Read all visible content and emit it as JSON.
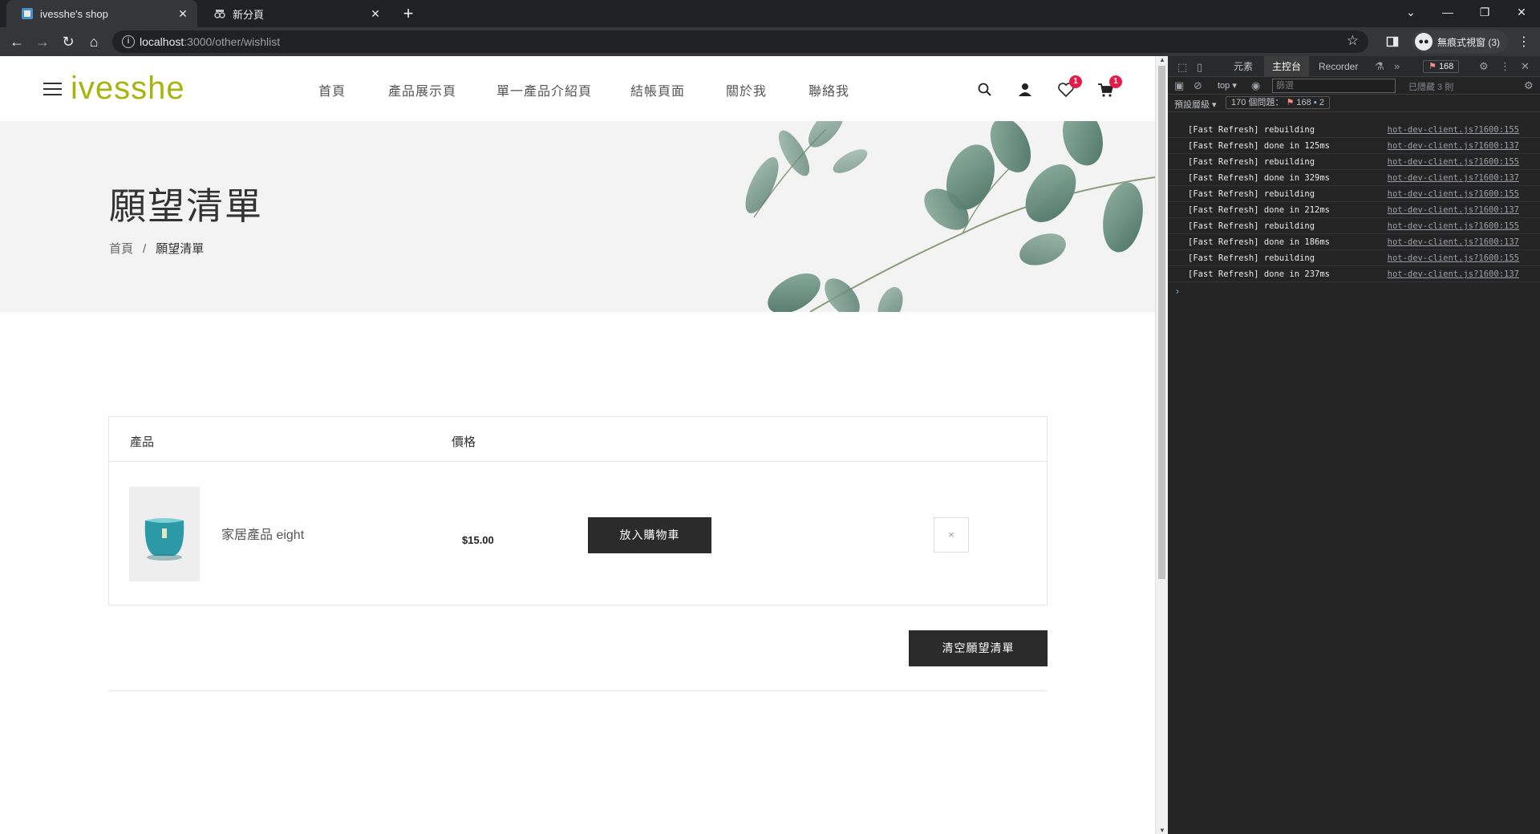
{
  "browser": {
    "tabs": [
      {
        "title": "ivesshe's shop",
        "active": true
      },
      {
        "title": "新分頁",
        "active": false
      }
    ],
    "url_host": "localhost",
    "url_path": ":3000/other/wishlist",
    "profile_label": "無痕式視窗 (3)"
  },
  "site": {
    "logo": "ivesshe",
    "menu": [
      "首頁",
      "產品展示頁",
      "單一產品介紹頁",
      "結帳頁面",
      "關於我",
      "聯絡我"
    ],
    "wishlist_count": "1",
    "cart_count": "1"
  },
  "hero": {
    "title": "願望清單",
    "breadcrumb_home": "首頁",
    "breadcrumb_sep": "/",
    "breadcrumb_current": "願望清單"
  },
  "wishlist": {
    "col_product": "產品",
    "col_price": "價格",
    "items": [
      {
        "name": "家居產品 eight",
        "price": "$15.00",
        "add_to_cart": "放入購物車",
        "remove": "×"
      }
    ],
    "clear_button": "清空願望清單"
  },
  "devtools": {
    "tabs": [
      "元素",
      "主控台",
      "Recorder"
    ],
    "active_tab": "主控台",
    "error_count": "168",
    "context": "top",
    "filter_placeholder": "篩選",
    "hidden_label": "已隱藏 3 則",
    "level_label": "預設層級",
    "issues_label": "170 個問題：",
    "issues_errors": "168",
    "issues_info": "2",
    "logs": [
      {
        "msg": "[Fast Refresh] rebuilding",
        "src": "hot-dev-client.js?1600:155"
      },
      {
        "msg": "[Fast Refresh] done in 125ms",
        "src": "hot-dev-client.js?1600:137"
      },
      {
        "msg": "[Fast Refresh] rebuilding",
        "src": "hot-dev-client.js?1600:155"
      },
      {
        "msg": "[Fast Refresh] done in 329ms",
        "src": "hot-dev-client.js?1600:137"
      },
      {
        "msg": "[Fast Refresh] rebuilding",
        "src": "hot-dev-client.js?1600:155"
      },
      {
        "msg": "[Fast Refresh] done in 212ms",
        "src": "hot-dev-client.js?1600:137"
      },
      {
        "msg": "[Fast Refresh] rebuilding",
        "src": "hot-dev-client.js?1600:155"
      },
      {
        "msg": "[Fast Refresh] done in 186ms",
        "src": "hot-dev-client.js?1600:137"
      },
      {
        "msg": "[Fast Refresh] rebuilding",
        "src": "hot-dev-client.js?1600:155"
      },
      {
        "msg": "[Fast Refresh] done in 237ms",
        "src": "hot-dev-client.js?1600:137"
      }
    ]
  },
  "colors": {
    "brand": "#a8b40e",
    "button_dark": "#2b2b2b",
    "badge": "#e11d48"
  }
}
